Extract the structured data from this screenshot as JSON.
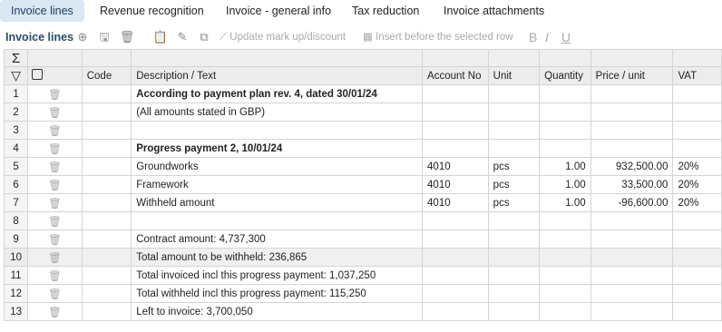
{
  "tabs": [
    "Invoice lines",
    "Revenue recognition",
    "Invoice - general info",
    "Tax reduction",
    "Invoice attachments"
  ],
  "toolbar": {
    "title": "Invoice lines",
    "update_markup": "Update mark up/discount",
    "insert_before": "Insert before the selected row",
    "format_bold": "B",
    "format_italic": "I",
    "format_underline": "U",
    "sum_symbol": "Σ",
    "filter_symbol": "▽"
  },
  "columns": {
    "code": "Code",
    "description": "Description / Text",
    "account": "Account No",
    "unit": "Unit",
    "quantity": "Quantity",
    "price": "Price / unit",
    "vat": "VAT"
  },
  "rows": [
    {
      "n": "1",
      "desc": "According to payment plan rev. 4, dated 30/01/24",
      "acct": "",
      "unit": "",
      "qty": "",
      "price": "",
      "vat": ""
    },
    {
      "n": "2",
      "desc": "(All amounts stated in GBP)",
      "acct": "",
      "unit": "",
      "qty": "",
      "price": "",
      "vat": ""
    },
    {
      "n": "3",
      "desc": "",
      "acct": "",
      "unit": "",
      "qty": "",
      "price": "",
      "vat": ""
    },
    {
      "n": "4",
      "desc": "Progress payment 2, 10/01/24",
      "acct": "",
      "unit": "",
      "qty": "",
      "price": "",
      "vat": ""
    },
    {
      "n": "5",
      "desc": "Groundworks",
      "acct": "4010",
      "unit": "pcs",
      "qty": "1.00",
      "price": "932,500.00",
      "vat": "20%"
    },
    {
      "n": "6",
      "desc": "Framework",
      "acct": "4010",
      "unit": "pcs",
      "qty": "1.00",
      "price": "33,500.00",
      "vat": "20%"
    },
    {
      "n": "7",
      "desc": "Withheld amount",
      "acct": "4010",
      "unit": "pcs",
      "qty": "1.00",
      "price": "-96,600.00",
      "vat": "20%"
    },
    {
      "n": "8",
      "desc": "",
      "acct": "",
      "unit": "",
      "qty": "",
      "price": "",
      "vat": ""
    },
    {
      "n": "9",
      "desc": "Contract amount: 4,737,300",
      "acct": "",
      "unit": "",
      "qty": "",
      "price": "",
      "vat": ""
    },
    {
      "n": "10",
      "desc": "Total amount to be withheld: 236,865",
      "acct": "",
      "unit": "",
      "qty": "",
      "price": "",
      "vat": ""
    },
    {
      "n": "11",
      "desc": "Total invoiced incl this progress payment: 1,037,250",
      "acct": "",
      "unit": "",
      "qty": "",
      "price": "",
      "vat": ""
    },
    {
      "n": "12",
      "desc": "Total withheld incl this progress payment: 115,250",
      "acct": "",
      "unit": "",
      "qty": "",
      "price": "",
      "vat": ""
    },
    {
      "n": "13",
      "desc": "Left to invoice: 3,700,050",
      "acct": "",
      "unit": "",
      "qty": "",
      "price": "",
      "vat": ""
    }
  ]
}
